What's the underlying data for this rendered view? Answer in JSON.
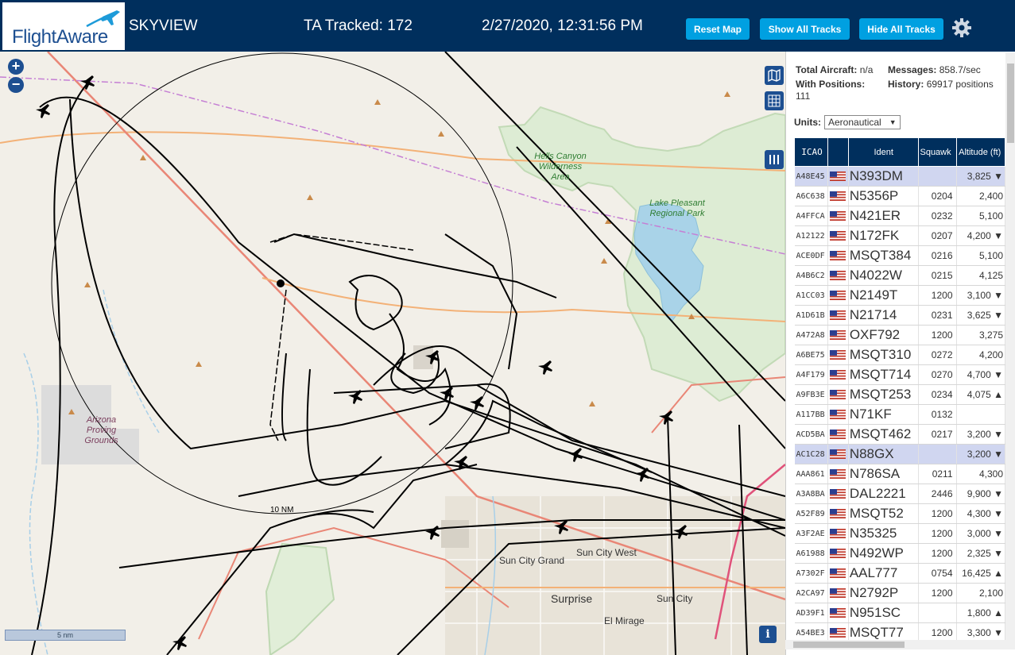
{
  "header": {
    "logo_text": "FlightAware",
    "title": "SKYVIEW",
    "tracked": "TA Tracked: 172",
    "datetime": "2/27/2020, 12:31:56 PM",
    "btn_reset": "Reset Map",
    "btn_show": "Show All Tracks",
    "btn_hide": "Hide All Tracks"
  },
  "map": {
    "zoom_in": "+",
    "zoom_out": "−",
    "scale": "5 nm",
    "ring_label": "10 NM",
    "info": "i",
    "labels": {
      "hells_canyon": "Hells Canyon Wilderness Area",
      "lake_pleasant": "Lake Pleasant Regional Park",
      "proving": "Arizona Proving Grounds",
      "sun_city_grand": "Sun City Grand",
      "sun_city_west": "Sun City West",
      "surprise": "Surprise",
      "sun_city": "Sun City",
      "el_mirage": "El Mirage"
    }
  },
  "stats": {
    "total_label": "Total Aircraft:",
    "total_value": "n/a",
    "messages_label": "Messages:",
    "messages_value": "858.7/sec",
    "positions_label": "With Positions:",
    "positions_value": "111",
    "history_label": "History:",
    "history_value": "69917 positions"
  },
  "units": {
    "label": "Units:",
    "value": "Aeronautical"
  },
  "table": {
    "headers": {
      "icao": "ICAO",
      "ident": "Ident",
      "squawk": "Squawk",
      "altitude": "Altitude (ft)"
    },
    "rows": [
      {
        "icao": "A48E45",
        "ident": "N393DM",
        "squawk": "",
        "alt": "3,825 ▼",
        "sel": true
      },
      {
        "icao": "A6C638",
        "ident": "N5356P",
        "squawk": "0204",
        "alt": "2,400",
        "sel": false
      },
      {
        "icao": "A4FFCA",
        "ident": "N421ER",
        "squawk": "0232",
        "alt": "5,100",
        "sel": false
      },
      {
        "icao": "A12122",
        "ident": "N172FK",
        "squawk": "0207",
        "alt": "4,200 ▼",
        "sel": false
      },
      {
        "icao": "ACE0DF",
        "ident": "MSQT384",
        "squawk": "0216",
        "alt": "5,100",
        "sel": false
      },
      {
        "icao": "A4B6C2",
        "ident": "N4022W",
        "squawk": "0215",
        "alt": "4,125",
        "sel": false
      },
      {
        "icao": "A1CC03",
        "ident": "N2149T",
        "squawk": "1200",
        "alt": "3,100 ▼",
        "sel": false
      },
      {
        "icao": "A1D61B",
        "ident": "N21714",
        "squawk": "0231",
        "alt": "3,625 ▼",
        "sel": false
      },
      {
        "icao": "A472A8",
        "ident": "OXF792",
        "squawk": "1200",
        "alt": "3,275",
        "sel": false
      },
      {
        "icao": "A6BE75",
        "ident": "MSQT310",
        "squawk": "0272",
        "alt": "4,200",
        "sel": false
      },
      {
        "icao": "A4F179",
        "ident": "MSQT714",
        "squawk": "0270",
        "alt": "4,700 ▼",
        "sel": false
      },
      {
        "icao": "A9FB3E",
        "ident": "MSQT253",
        "squawk": "0234",
        "alt": "4,075 ▲",
        "sel": false
      },
      {
        "icao": "A117BB",
        "ident": "N71KF",
        "squawk": "0132",
        "alt": "",
        "sel": false
      },
      {
        "icao": "ACD5BA",
        "ident": "MSQT462",
        "squawk": "0217",
        "alt": "3,200 ▼",
        "sel": false
      },
      {
        "icao": "AC1C28",
        "ident": "N88GX",
        "squawk": "",
        "alt": "3,200 ▼",
        "sel": true
      },
      {
        "icao": "AAA861",
        "ident": "N786SA",
        "squawk": "0211",
        "alt": "4,300",
        "sel": false
      },
      {
        "icao": "A3A8BA",
        "ident": "DAL2221",
        "squawk": "2446",
        "alt": "9,900 ▼",
        "sel": false
      },
      {
        "icao": "A52F89",
        "ident": "MSQT52",
        "squawk": "1200",
        "alt": "4,300 ▼",
        "sel": false
      },
      {
        "icao": "A3F2AE",
        "ident": "N35325",
        "squawk": "1200",
        "alt": "3,000 ▼",
        "sel": false
      },
      {
        "icao": "A61988",
        "ident": "N492WP",
        "squawk": "1200",
        "alt": "2,325 ▼",
        "sel": false
      },
      {
        "icao": "A7302F",
        "ident": "AAL777",
        "squawk": "0754",
        "alt": "16,425 ▲",
        "sel": false
      },
      {
        "icao": "A2CA97",
        "ident": "N2792P",
        "squawk": "1200",
        "alt": "2,100",
        "sel": false
      },
      {
        "icao": "AD39F1",
        "ident": "N951SC",
        "squawk": "",
        "alt": "1,800 ▲",
        "sel": false
      },
      {
        "icao": "A54BE3",
        "ident": "MSQT77",
        "squawk": "1200",
        "alt": "3,300 ▼",
        "sel": false
      }
    ]
  },
  "colors": {
    "header_bg": "#002f5d",
    "button": "#00a0e1",
    "selected_row": "#d0d6f0"
  }
}
